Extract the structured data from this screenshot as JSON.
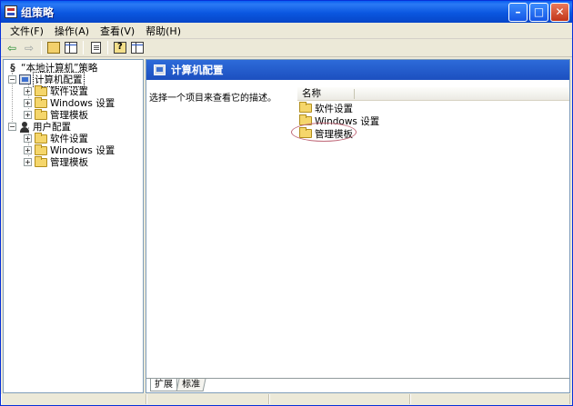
{
  "window": {
    "title": "组策略"
  },
  "menubar": {
    "items": [
      "文件(F)",
      "操作(A)",
      "查看(V)",
      "帮助(H)"
    ]
  },
  "toolbar": {
    "back_icon": "arrow-left-icon",
    "forward_icon": "arrow-right-icon"
  },
  "tree": {
    "root": "“本地计算机”策略",
    "computer_config": "计算机配置",
    "user_config": "用户配置",
    "computer_children": [
      "软件设置",
      "Windows 设置",
      "管理模板"
    ],
    "user_children": [
      "软件设置",
      "Windows 设置",
      "管理模板"
    ]
  },
  "right": {
    "header_title": "计算机配置",
    "description": "选择一个项目来查看它的描述。",
    "column_name": "名称",
    "items": [
      "软件设置",
      "Windows 设置",
      "管理模板"
    ]
  },
  "tabs": {
    "extended": "扩展",
    "standard": "标准"
  },
  "colors": {
    "titlebar": "#0b57e0",
    "header_bar": "#2d6bd9",
    "highlight_ring": "#c06a7a"
  }
}
